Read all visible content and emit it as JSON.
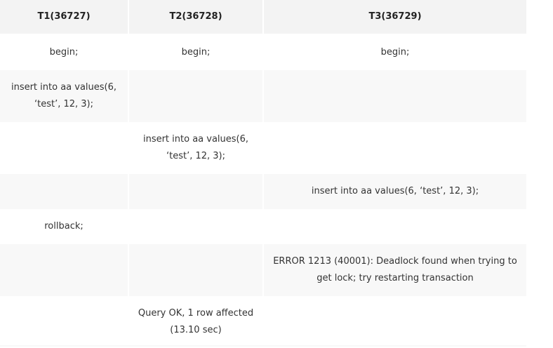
{
  "table": {
    "headers": [
      "T1(36727)",
      "T2(36728)",
      "T3(36729)"
    ],
    "rows": [
      [
        "begin;",
        "begin;",
        "begin;"
      ],
      [
        "insert into aa values(6, ‘test’, 12, 3);",
        "",
        ""
      ],
      [
        "",
        "insert into aa values(6, ‘test’, 12, 3);",
        ""
      ],
      [
        "",
        "",
        "insert into aa values(6, ‘test’, 12, 3);"
      ],
      [
        "rollback;",
        "",
        ""
      ],
      [
        "",
        "",
        "ERROR 1213 (40001): Deadlock found when trying to get lock; try restarting transaction"
      ],
      [
        "",
        "Query OK, 1 row affected (13.10 sec)",
        ""
      ]
    ]
  }
}
